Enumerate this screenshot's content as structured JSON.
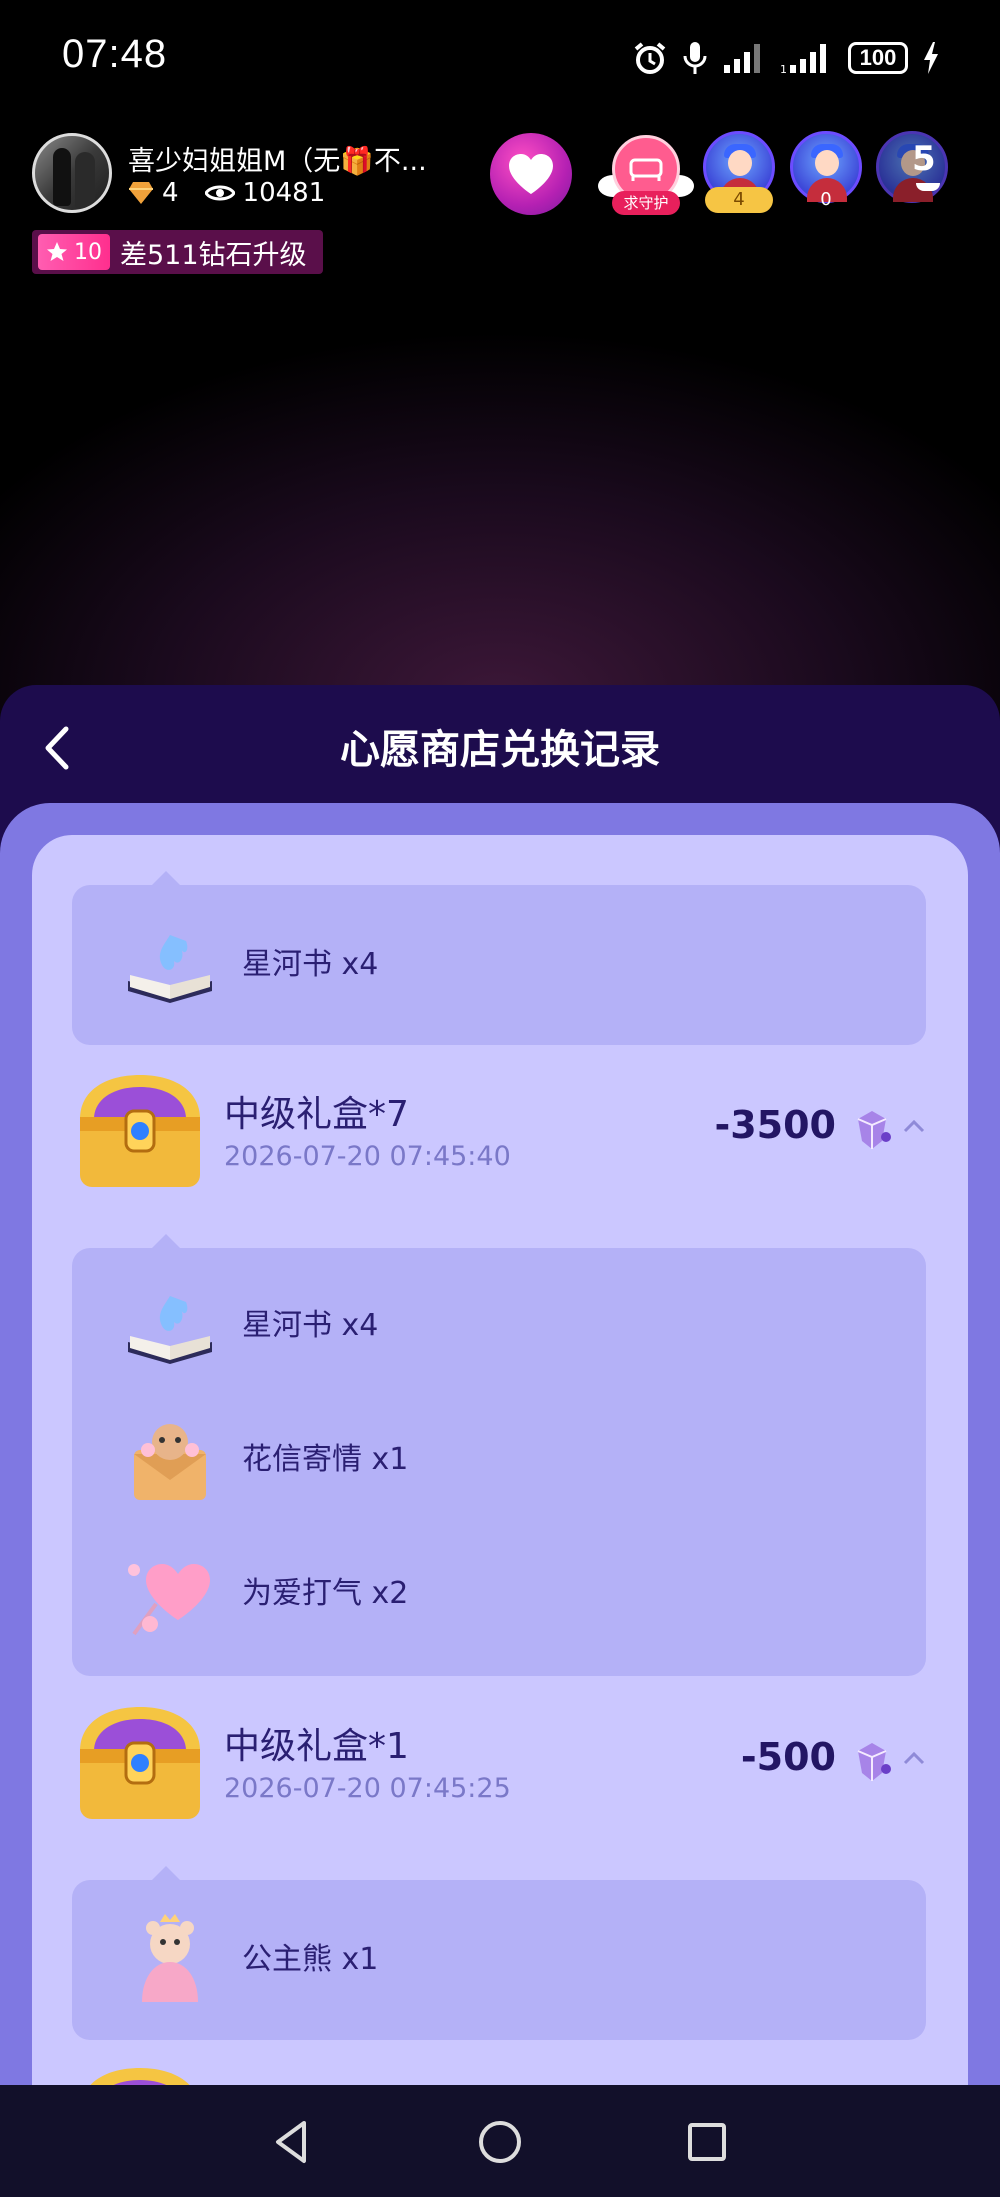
{
  "status_bar": {
    "time": "07:48",
    "battery": "100"
  },
  "host": {
    "name": "喜少妇姐姐M（无🎁不...",
    "diamonds": "4",
    "views": "10481",
    "level": "10",
    "upgrade_text": "差511钻石升级"
  },
  "guard": {
    "label": "求守护"
  },
  "viewers": [
    {
      "count": "4"
    },
    {
      "count": "0"
    }
  ],
  "online_count": "5",
  "sheet": {
    "title": "心愿商店兑换记录"
  },
  "records": [
    {
      "items": [
        {
          "icon": "star-river-book-icon",
          "label": "星河书 x4"
        }
      ]
    },
    {
      "name": "中级礼盒*7",
      "date": "2026-07-20 07:45:40",
      "amount": "-3500",
      "items": [
        {
          "icon": "star-river-book-icon",
          "label": "星河书 x4"
        },
        {
          "icon": "flower-letter-icon",
          "label": "花信寄情 x1"
        },
        {
          "icon": "love-balloon-icon",
          "label": "为爱打气 x2"
        }
      ]
    },
    {
      "name": "中级礼盒*1",
      "date": "2026-07-20 07:45:25",
      "amount": "-500",
      "items": [
        {
          "icon": "princess-bear-icon",
          "label": "公主熊 x1"
        }
      ]
    }
  ],
  "colors": {
    "sheet_header": "#1d0c4d",
    "outer_panel": "#7f78e2",
    "card": "#cbc7ff",
    "sub_panel": "#b4b1f7",
    "text_dark": "#2a1f72",
    "date_text": "#7a78c8"
  }
}
